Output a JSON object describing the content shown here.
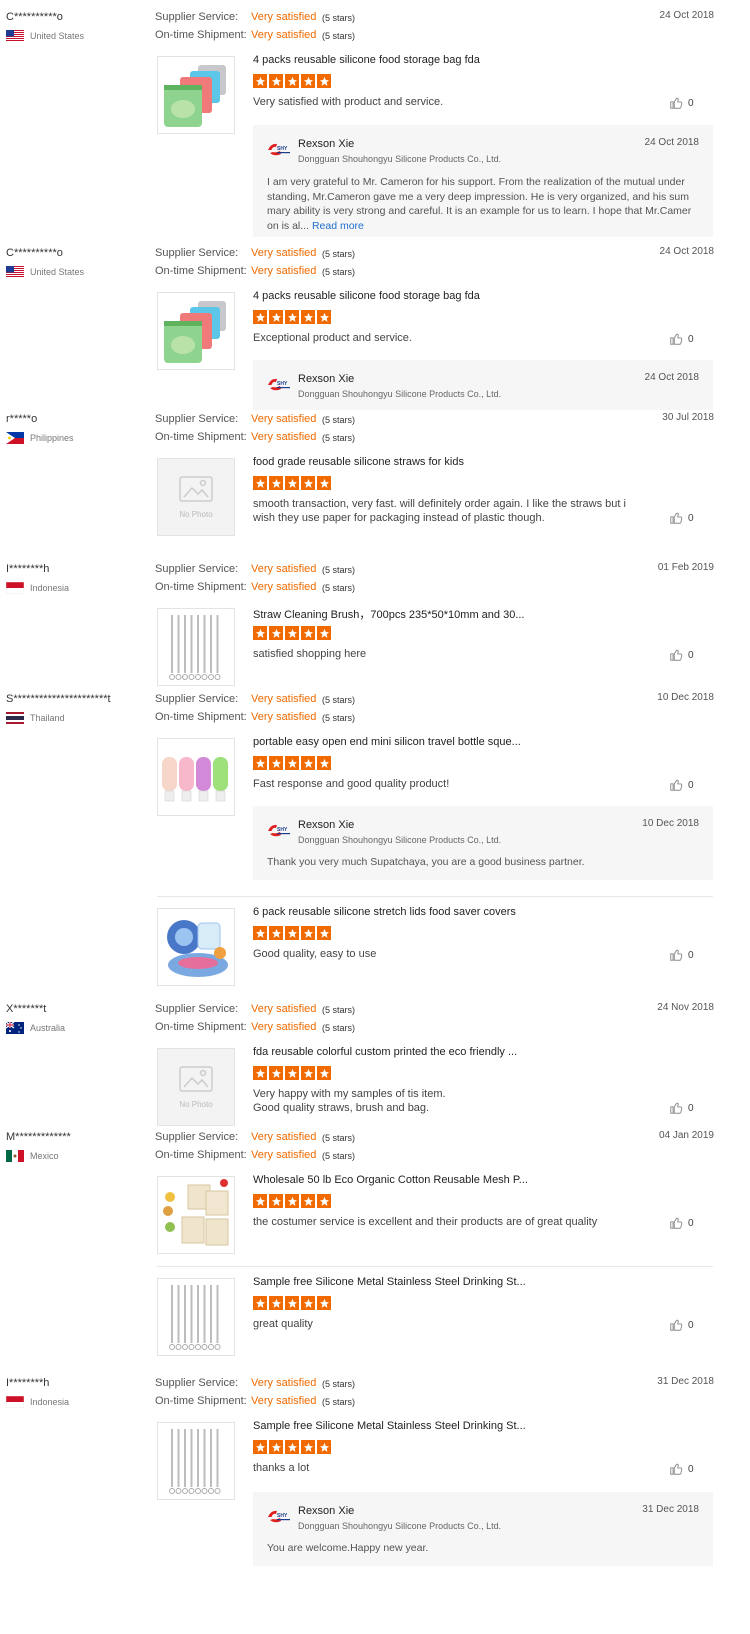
{
  "labels": {
    "supplier_service": "Supplier Service:",
    "ontime_shipment": "On-time Shipment:",
    "very_satisfied": "Very satisfied",
    "five_stars": "(5 stars)",
    "read_more": "Read more",
    "no_photo": "No Photo"
  },
  "colors": {
    "accent": "#f06a00",
    "link": "#1e6fd0",
    "reply_bg": "#f6f6f6"
  },
  "reviews": [
    {
      "name": "C**********o",
      "country": "United States",
      "flag": "us",
      "date": "24 Oct 2018",
      "product": "4 packs reusable silicone food storage bag fda",
      "text": "Very satisfied with product and service.",
      "likes": "0",
      "reply": {
        "name": "Rexson Xie",
        "company": "Dongguan Shouhongyu Silicone Products Co., Ltd.",
        "date": "24 Oct 2018",
        "lines": [
          "I am very grateful to Mr. Cameron for his support. From the realization of the mutual under",
          "standing, Mr.Cameron gave me a very deep impression. He is very organized, and his sum",
          "mary ability is very strong and careful. It is an example for us to learn. I hope that Mr.Camer",
          "on is al..."
        ]
      }
    },
    {
      "name": "C**********o",
      "country": "United States",
      "flag": "us",
      "date": "24 Oct 2018",
      "product": "4 packs reusable silicone food storage bag fda",
      "text": "Exceptional product and service.",
      "likes": "0",
      "reply": {
        "name": "Rexson Xie",
        "company": "Dongguan Shouhongyu Silicone Products Co., Ltd.",
        "date": "24 Oct 2018"
      }
    },
    {
      "name": "r*****o",
      "country": "Philippines",
      "flag": "ph",
      "date": "30 Jul 2018",
      "product": "food grade reusable silicone straws for kids",
      "likes": "0",
      "text_lines": [
        "smooth transaction, very fast. will definitely order again. I like the straws but i",
        "wish they use paper for packaging instead of plastic though."
      ]
    },
    {
      "name": "I********h",
      "country": "Indonesia",
      "flag": "id",
      "date": "01 Feb 2019",
      "product": "Straw Cleaning Brush，700pcs 235*50*10mm and 30...",
      "text": "satisfied shopping here",
      "likes": "0"
    },
    {
      "name": "S**********************t",
      "country": "Thailand",
      "flag": "th",
      "date": "10 Dec 2018",
      "product": "portable easy open end mini silicon travel bottle sque...",
      "text": "Fast response and good quality product!",
      "likes": "0",
      "reply": {
        "name": "Rexson Xie",
        "company": "Dongguan Shouhongyu Silicone Products Co., Ltd.",
        "date": "10 Dec 2018",
        "message": "Thank you very much Supatchaya, you are a good business partner."
      },
      "extra": {
        "product": "6 pack reusable silicone stretch lids food saver covers",
        "text": "Good quality, easy to use",
        "likes": "0"
      }
    },
    {
      "name": "X*******t",
      "country": "Australia",
      "flag": "au",
      "date": "24 Nov 2018",
      "product": "fda reusable colorful custom printed the eco friendly ...",
      "likes": "0",
      "text_lines": [
        "Very happy with my samples of tis item.",
        "Good quality straws, brush and bag."
      ]
    },
    {
      "name": "M*************",
      "country": "Mexico",
      "flag": "mx",
      "date": "04 Jan 2019",
      "product": "Wholesale 50 lb Eco Organic Cotton Reusable Mesh P...",
      "text": "the costumer service is excellent and their products are of great quality",
      "likes": "0",
      "extra": {
        "product": "Sample free Silicone Metal Stainless Steel Drinking St...",
        "text": "great quality",
        "likes": "0"
      }
    },
    {
      "name": "I********h",
      "country": "Indonesia",
      "flag": "id",
      "date": "31 Dec 2018",
      "product": "Sample free Silicone Metal Stainless Steel Drinking St...",
      "text": "thanks a lot",
      "likes": "0",
      "reply": {
        "name": "Rexson Xie",
        "company": "Dongguan Shouhongyu Silicone Products Co., Ltd.",
        "date": "31 Dec 2018",
        "message": "You are welcome.Happy new year."
      }
    }
  ]
}
